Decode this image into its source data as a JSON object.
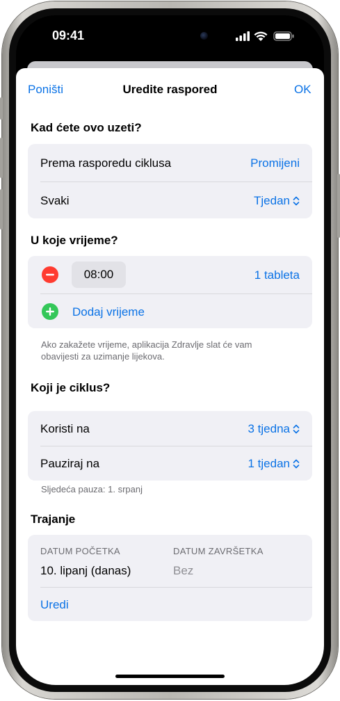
{
  "status_bar": {
    "time": "09:41"
  },
  "nav": {
    "cancel": "Poništi",
    "title": "Uredite raspored",
    "done": "OK"
  },
  "when": {
    "title": "Kad ćete ovo uzeti?",
    "rows": [
      {
        "label": "Prema rasporedu ciklusa",
        "value": "Promijeni"
      },
      {
        "label": "Svaki",
        "value": "Tjedan"
      }
    ]
  },
  "time_section": {
    "title": "U koje vrijeme?",
    "time": "08:00",
    "dose": "1 tableta",
    "add": "Dodaj vrijeme",
    "footnote": "Ako zakažete vrijeme, aplikacija Zdravlje slat će vam obavijesti za uzimanje lijekova."
  },
  "cycle": {
    "title": "Koji je ciklus?",
    "rows": [
      {
        "label": "Koristi na",
        "value": "3 tjedna"
      },
      {
        "label": "Pauziraj na",
        "value": "1 tjedan"
      }
    ],
    "note": "Sljedeća pauza: 1. srpanj"
  },
  "duration": {
    "title": "Trajanje",
    "start_label": "DATUM POČETKA",
    "start_value": "10. lipanj (danas)",
    "end_label": "DATUM ZAVRŠETKA",
    "end_value": "Bez",
    "edit": "Uredi"
  },
  "colors": {
    "accent": "#0a72e6",
    "remove": "#ff3b30",
    "add": "#34c759",
    "group_bg": "#f0f0f5"
  }
}
